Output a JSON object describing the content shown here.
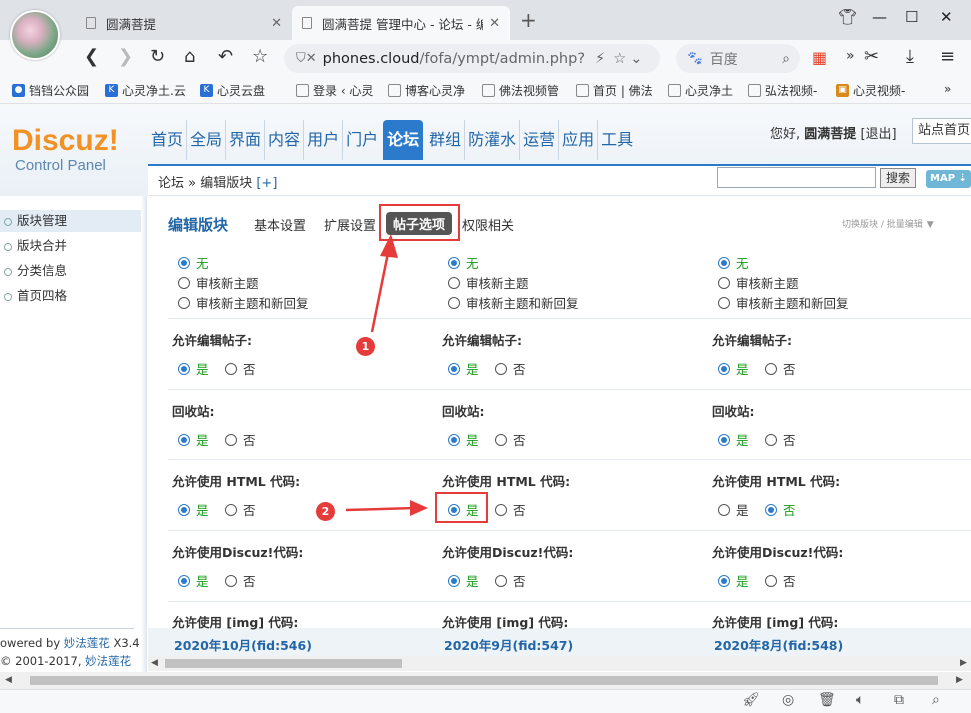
{
  "browser": {
    "tabs": [
      {
        "title": "圆满菩提"
      },
      {
        "title": "圆满菩提 管理中心 - 论坛 - 编"
      }
    ],
    "url_host": "phones.cloud",
    "url_path": "/fofa/ympt/admin.php?",
    "search_placeholder": "百度",
    "bookmarks": [
      "铛铛公众园",
      "心灵净土.云",
      "心灵云盘",
      "登录 ‹ 心灵",
      "博客心灵净",
      "佛法视频管",
      "首页 | 佛法",
      "心灵净土",
      "弘法视频-",
      "心灵视频-"
    ],
    "bookmarks_more": "»"
  },
  "header": {
    "logo": "Discuz!",
    "logo_sub": "Control Panel",
    "nav": [
      "首页",
      "全局",
      "界面",
      "内容",
      "用户",
      "门户",
      "论坛",
      "群组",
      "防灌水",
      "运营",
      "应用",
      "工具"
    ],
    "active_nav": "论坛",
    "greeting_prefix": "您好,",
    "username": "圆满菩提",
    "logout": "[退出]",
    "site_home": "站点首页"
  },
  "subbar": {
    "crumb": "论坛 » 编辑版块",
    "crumb_plus": "[+]",
    "search_button": "搜索",
    "map_button": "MAP ⇣"
  },
  "sidebar": {
    "items": [
      "版块管理",
      "版块合并",
      "分类信息",
      "首页四格"
    ],
    "active_index": 0,
    "powered_prefix": "owered by ",
    "powered_link": "妙法莲花",
    "powered_suffix": " X3.4",
    "copy_prefix": "© 2001-2017, ",
    "copy_link": "妙法莲花"
  },
  "content": {
    "title": "编辑版块",
    "tabs": [
      "基本设置",
      "扩展设置",
      "帖子选项",
      "权限相关"
    ],
    "active_tab": "帖子选项",
    "switch_link": "切换版块 / 批量编辑",
    "moderation_options": [
      "无",
      "审核新主题",
      "审核新主题和新回复"
    ],
    "settings": [
      {
        "label": "允许编辑帖子:",
        "values": [
          "是",
          "是",
          "是"
        ]
      },
      {
        "label": "回收站:",
        "values": [
          "是",
          "是",
          "是"
        ]
      },
      {
        "label": "允许使用 HTML 代码:",
        "values": [
          "是",
          "是",
          "否"
        ]
      },
      {
        "label": "允许使用Discuz!代码:",
        "values": [
          "是",
          "是",
          "是"
        ]
      }
    ],
    "img_label": "允许使用 [img] 代码:",
    "yes": "是",
    "no": "否",
    "columns": [
      "2020年10月(fid:546)",
      "2020年9月(fid:547)",
      "2020年8月(fid:548)"
    ]
  },
  "annotations": {
    "badge1": "1",
    "badge2": "2",
    "color": "#e53b3b"
  }
}
